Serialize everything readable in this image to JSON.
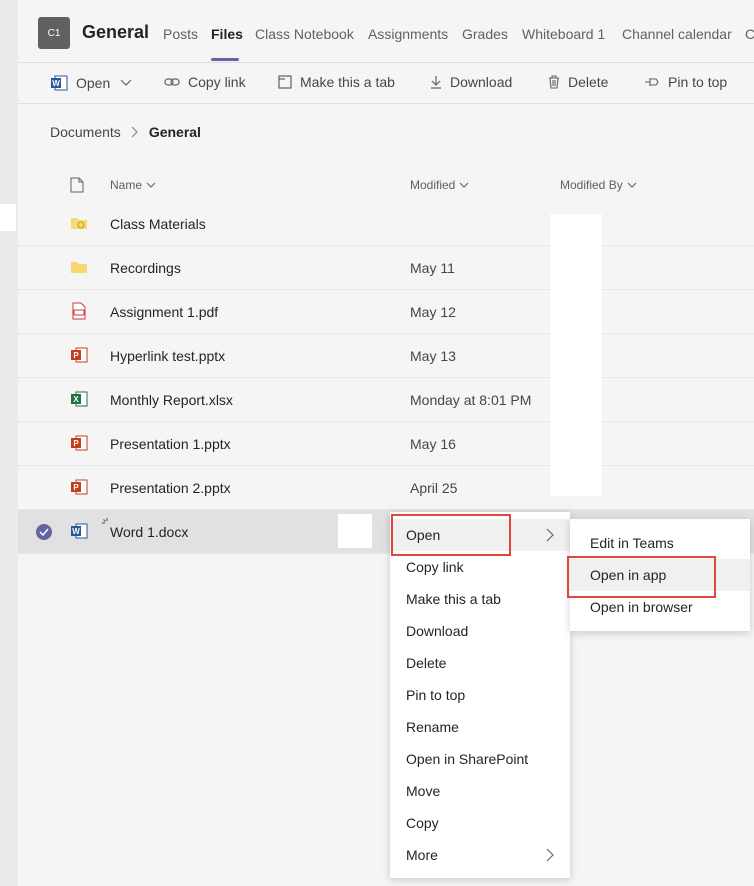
{
  "header": {
    "avatar_text": "C1",
    "team_title": "General",
    "tabs": [
      {
        "label": "Posts"
      },
      {
        "label": "Files"
      },
      {
        "label": "Class Notebook"
      },
      {
        "label": "Assignments"
      },
      {
        "label": "Grades"
      },
      {
        "label": "Whiteboard 1"
      },
      {
        "label": "Channel calendar"
      },
      {
        "label": "C"
      }
    ],
    "active_tab": "Files"
  },
  "toolbar": {
    "open_label": "Open",
    "copy_link_label": "Copy link",
    "make_tab_label": "Make this a tab",
    "download_label": "Download",
    "delete_label": "Delete",
    "pin_label": "Pin to top"
  },
  "breadcrumb": {
    "root": "Documents",
    "current": "General"
  },
  "table": {
    "columns": {
      "name": "Name",
      "modified": "Modified",
      "modified_by": "Modified By"
    },
    "rows": [
      {
        "name": "Class Materials",
        "modified": "",
        "type": "folder-special"
      },
      {
        "name": "Recordings",
        "modified": "May 11",
        "type": "folder"
      },
      {
        "name": "Assignment 1.pdf",
        "modified": "May 12",
        "type": "pdf"
      },
      {
        "name": "Hyperlink test.pptx",
        "modified": "May 13",
        "type": "pptx"
      },
      {
        "name": "Monthly Report.xlsx",
        "modified": "Monday at 8:01 PM",
        "type": "xlsx"
      },
      {
        "name": "Presentation 1.pptx",
        "modified": "May 16",
        "type": "pptx"
      },
      {
        "name": "Presentation 2.pptx",
        "modified": "April 25",
        "type": "pptx"
      },
      {
        "name": "Word 1.docx",
        "modified": "",
        "type": "docx",
        "selected": true
      }
    ]
  },
  "context_menu": {
    "items": [
      {
        "label": "Open",
        "submenu": true
      },
      {
        "label": "Copy link"
      },
      {
        "label": "Make this a tab"
      },
      {
        "label": "Download"
      },
      {
        "label": "Delete"
      },
      {
        "label": "Pin to top"
      },
      {
        "label": "Rename"
      },
      {
        "label": "Open in SharePoint"
      },
      {
        "label": "Move"
      },
      {
        "label": "Copy"
      },
      {
        "label": "More",
        "submenu": true
      }
    ]
  },
  "open_submenu": {
    "items": [
      {
        "label": "Edit in Teams"
      },
      {
        "label": "Open in app",
        "hovered": true
      },
      {
        "label": "Open in browser"
      }
    ]
  },
  "colors": {
    "accent": "#6264a7",
    "highlight_box": "#e3463c",
    "word_blue": "#2b579a",
    "excel_green": "#217346",
    "ppt_orange": "#c43e1c",
    "pdf_red": "#d13438",
    "folder_yellow": "#f8d775"
  }
}
